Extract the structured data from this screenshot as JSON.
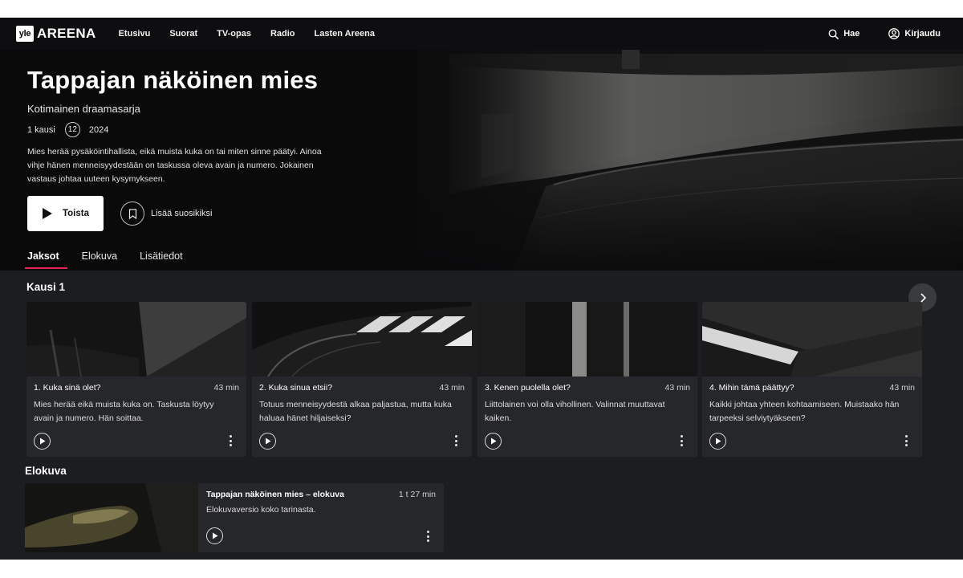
{
  "nav": {
    "logo_box": "yle",
    "logo_word": "AREENA",
    "links": [
      "Etusivu",
      "Suorat",
      "TV-opas",
      "Radio",
      "Lasten Areena"
    ],
    "search_label": "Hae",
    "login_label": "Kirjaudu"
  },
  "hero": {
    "title": "Tappajan näköinen mies",
    "subtitle": "Kotimainen draamasarja",
    "seasons": "1 kausi",
    "age_rating": "12",
    "year": "2024",
    "description": "Mies herää pysäköintihallista, eikä muista kuka on tai miten sinne päätyi. Ainoa vihje hänen menneisyydestään on taskussa oleva avain ja numero. Jokainen vastaus johtaa uuteen kysymykseen.",
    "play_label": "Toista",
    "favorite_label": "Lisää suosikiksi"
  },
  "tabs": [
    {
      "label": "Jaksot",
      "active": true
    },
    {
      "label": "Elokuva",
      "active": false
    },
    {
      "label": "Lisätiedot",
      "active": false
    }
  ],
  "season": {
    "title": "Kausi 1",
    "episodes": [
      {
        "title": "1. Kuka sinä olet?",
        "duration": "43 min",
        "description": "Mies herää eikä muista kuka on. Taskusta löytyy avain ja numero. Hän soittaa."
      },
      {
        "title": "2. Kuka sinua etsii?",
        "duration": "43 min",
        "description": "Totuus menneisyydestä alkaa paljastua, mutta kuka haluaa hänet hiljaiseksi?"
      },
      {
        "title": "3. Kenen puolella olet?",
        "duration": "43 min",
        "description": "Liittolainen voi olla vihollinen. Valinnat muuttavat kaiken."
      },
      {
        "title": "4. Mihin tämä päättyy?",
        "duration": "43 min",
        "description": "Kaikki johtaa yhteen kohtaamiseen. Muistaako hän tarpeeksi selviytyäkseen?"
      }
    ]
  },
  "movie_section": {
    "title": "Elokuva",
    "item": {
      "title": "Tappajan näköinen mies – elokuva",
      "duration": "1 t 27 min",
      "description": "Elokuvaversio koko tarinasta."
    }
  },
  "colors": {
    "accent": "#e6245a",
    "background": "#1c1d20",
    "card": "#26272b"
  }
}
